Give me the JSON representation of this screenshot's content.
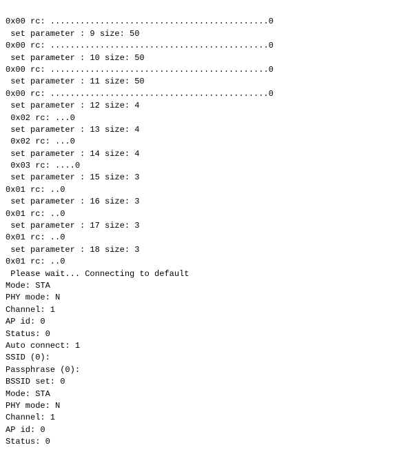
{
  "terminal": {
    "lines": [
      "0x00 rc: ............................................0",
      " set parameter : 9 size: 50",
      "0x00 rc: ............................................0",
      " set parameter : 10 size: 50",
      "0x00 rc: ............................................0",
      " set parameter : 11 size: 50",
      "0x00 rc: ............................................0",
      " set parameter : 12 size: 4",
      " 0x02 rc: ...0",
      " set parameter : 13 size: 4",
      " 0x02 rc: ...0",
      " set parameter : 14 size: 4",
      " 0x03 rc: ....0",
      " set parameter : 15 size: 3",
      "0x01 rc: ..0",
      " set parameter : 16 size: 3",
      "0x01 rc: ..0",
      " set parameter : 17 size: 3",
      "0x01 rc: ..0",
      " set parameter : 18 size: 3",
      "0x01 rc: ..0",
      "",
      " Please wait... Connecting to default",
      "Mode: STA",
      "PHY mode: N",
      "Channel: 1",
      "AP id: 0",
      "Status: 0",
      "Auto connect: 1",
      "SSID (0):",
      "Passphrase (0):",
      "BSSID set: 0",
      "Mode: STA",
      "PHY mode: N",
      "Channel: 1",
      "AP id: 0",
      "Status: 0"
    ]
  }
}
